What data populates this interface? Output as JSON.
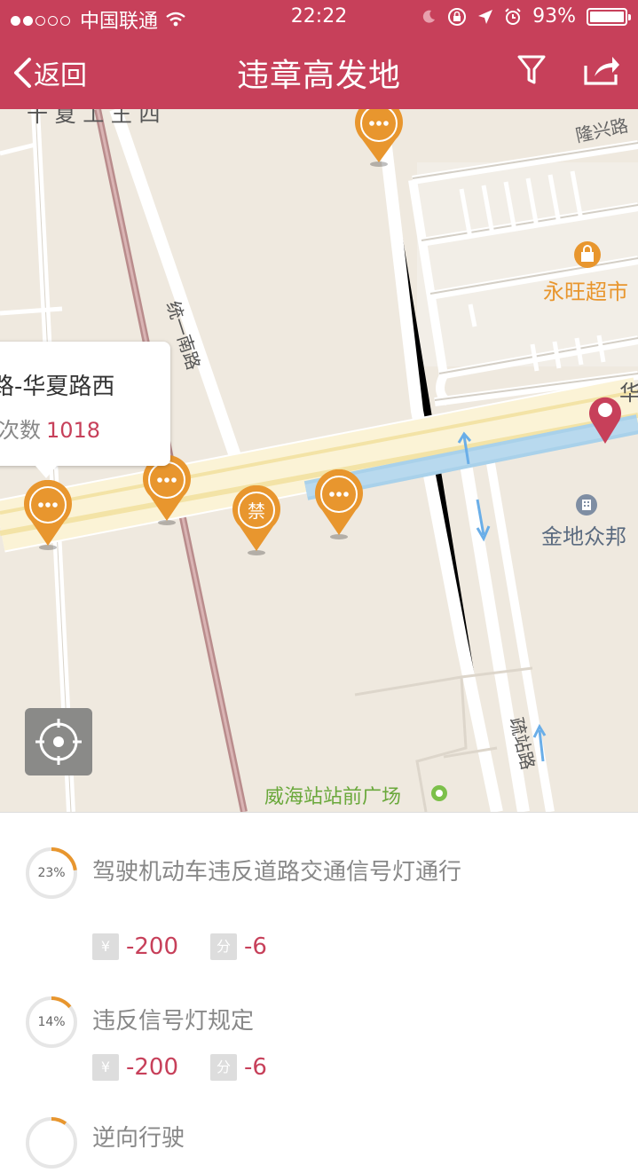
{
  "status": {
    "carrier": "中国联通",
    "time": "22:22",
    "battery": "93%",
    "battery_level": 0.93
  },
  "nav": {
    "back_label": "返回",
    "title": "违章高发地",
    "filter_icon": "funnel-icon",
    "share_icon": "share-icon"
  },
  "map": {
    "road_labels": {
      "longxing": "隆兴路",
      "tongyi_south": "统一南路",
      "shuzhan": "疏站路",
      "hua_partial": "华",
      "top_partial": "十 夏 工 王 四"
    },
    "poi": {
      "yongwang": "永旺超市",
      "jindi": "金地众邦",
      "weihai_station": "威海站站前广场"
    },
    "callout": {
      "title": "路-华夏路西",
      "count_label": "次数",
      "count_value": "1018"
    },
    "pins": [
      {
        "type": "more",
        "glyph": "···"
      },
      {
        "type": "more",
        "glyph": "···"
      },
      {
        "type": "forbidden",
        "glyph": "禁"
      },
      {
        "type": "more",
        "glyph": "···"
      },
      {
        "type": "more",
        "glyph": "···"
      }
    ],
    "accent": "#e8962e",
    "brand": "#c7405a"
  },
  "violations": [
    {
      "percent": "23%",
      "ratio": 0.23,
      "title": "驾驶机动车违反道路交通信号灯通行",
      "fine_tag": "¥",
      "fine": "-200",
      "points_tag": "分",
      "points": "-6"
    },
    {
      "percent": "14%",
      "ratio": 0.14,
      "title": "违反信号灯规定",
      "fine_tag": "¥",
      "fine": "-200",
      "points_tag": "分",
      "points": "-6"
    },
    {
      "percent": "",
      "ratio": 0.1,
      "title": "逆向行驶"
    }
  ]
}
